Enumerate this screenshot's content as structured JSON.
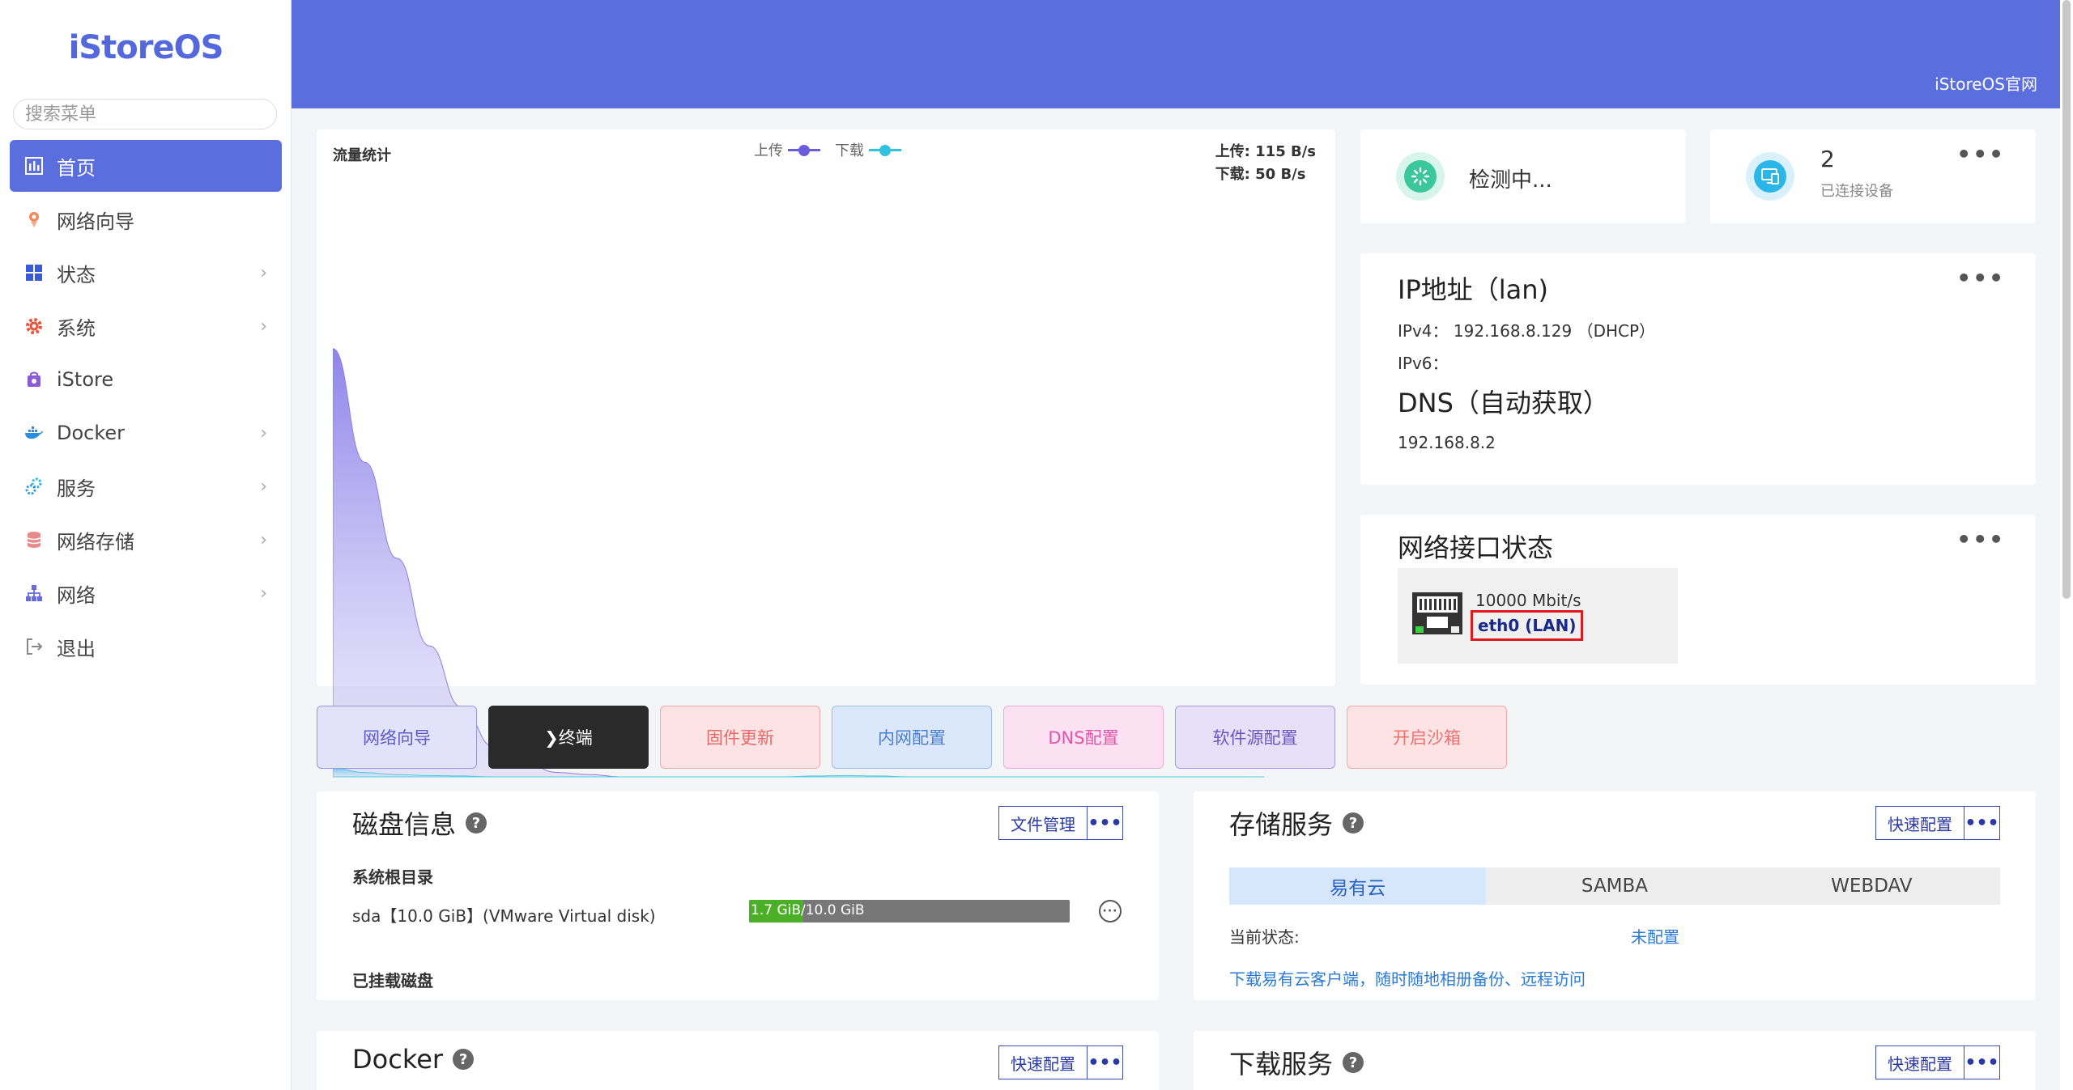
{
  "sidebar": {
    "logo": "iStoreOS",
    "search_placeholder": "搜索菜单",
    "items": [
      {
        "label": "首页",
        "active": true,
        "has_children": false,
        "icon": "dashboard-icon"
      },
      {
        "label": "网络向导",
        "active": false,
        "has_children": false,
        "icon": "location-icon"
      },
      {
        "label": "状态",
        "active": false,
        "has_children": true,
        "icon": "grid-icon"
      },
      {
        "label": "系统",
        "active": false,
        "has_children": true,
        "icon": "gear-icon"
      },
      {
        "label": "iStore",
        "active": false,
        "has_children": false,
        "icon": "store-icon"
      },
      {
        "label": "Docker",
        "active": false,
        "has_children": true,
        "icon": "docker-icon"
      },
      {
        "label": "服务",
        "active": false,
        "has_children": true,
        "icon": "services-icon"
      },
      {
        "label": "网络存储",
        "active": false,
        "has_children": true,
        "icon": "database-icon"
      },
      {
        "label": "网络",
        "active": false,
        "has_children": true,
        "icon": "network-icon"
      },
      {
        "label": "退出",
        "active": false,
        "has_children": false,
        "icon": "logout-icon"
      }
    ]
  },
  "header": {
    "official_link": "iStoreOS官网",
    "color": "#5a6fdd"
  },
  "traffic": {
    "title": "流量统计",
    "legend_upload": "上传",
    "legend_download": "下载",
    "upload_rate": "上传: 115 B/s",
    "download_rate": "下载: 50 B/s",
    "upload_color": "#6a5ce0",
    "download_color": "#2fc3e0"
  },
  "chart_data": {
    "type": "area",
    "series": [
      {
        "name": "上传",
        "values": [
          98,
          72,
          50,
          30,
          16,
          7,
          3,
          1,
          0.5,
          0,
          0,
          0,
          0,
          0,
          0,
          0,
          0,
          0,
          0,
          0,
          0,
          0,
          0,
          0,
          0,
          0,
          0,
          0,
          0,
          0
        ]
      },
      {
        "name": "下载",
        "values": [
          2,
          1,
          0.5,
          0.3,
          0.2,
          0,
          0,
          0,
          0,
          0,
          0,
          0,
          0,
          0,
          0,
          0.2,
          0.3,
          0.2,
          0,
          0,
          0,
          0,
          0,
          0,
          0,
          0,
          0,
          0,
          0,
          0
        ]
      }
    ],
    "title": "流量统计",
    "grid": false
  },
  "status": {
    "detect_text": "检测中...",
    "device_count": "2",
    "device_label": "已连接设备"
  },
  "ip": {
    "title": "IP地址（lan)",
    "ipv4_label": "IPv4：",
    "ipv4_value": "192.168.8.129 （DHCP）",
    "ipv6_label": "IPv6：",
    "dns_title": "DNS（自动获取）",
    "dns_value": "192.168.8.2"
  },
  "netif": {
    "title": "网络接口状态",
    "speed": "10000 Mbit/s",
    "name": "eth0 (LAN)"
  },
  "quick_buttons": [
    {
      "label": "网络向导",
      "bg": "#e3e2fb",
      "border": "#9b96e3",
      "color": "#5a5bc8"
    },
    {
      "label": "❯终端",
      "bg": "#2a2a2a",
      "border": "#2a2a2a",
      "color": "#ffffff"
    },
    {
      "label": "固件更新",
      "bg": "#fde3e3",
      "border": "#f0a8a8",
      "color": "#e56a6a"
    },
    {
      "label": "内网配置",
      "bg": "#dbe8fb",
      "border": "#9dbde8",
      "color": "#4a7ed0"
    },
    {
      "label": "DNS配置",
      "bg": "#fce1f2",
      "border": "#eeaad4",
      "color": "#e056a8"
    },
    {
      "label": "软件源配置",
      "bg": "#e6e1f9",
      "border": "#a799e0",
      "color": "#6a55c2"
    },
    {
      "label": "开启沙箱",
      "bg": "#fde3e3",
      "border": "#f0a8a8",
      "color": "#f07070"
    }
  ],
  "disk": {
    "title": "磁盘信息",
    "help": "?",
    "button": "文件管理",
    "more": "•••",
    "root_label": "系统根目录",
    "disk_line": "sda【10.0 GiB】(VMware Virtual disk)",
    "usage_text": "1.7 GiB/10.0 GiB",
    "usage_fraction": 0.17,
    "mounted_label": "已挂载磁盘"
  },
  "storage": {
    "title": "存储服务",
    "help": "?",
    "button": "快速配置",
    "more": "•••",
    "tabs": [
      "易有云",
      "SAMBA",
      "WEBDAV"
    ],
    "status_label": "当前状态:",
    "status_value": "未配置",
    "link": "下载易有云客户端，随时随地相册备份、远程访问"
  },
  "docker": {
    "title": "Docker",
    "help": "?",
    "button": "快速配置",
    "more": "•••"
  },
  "download": {
    "title": "下载服务",
    "help": "?",
    "button": "快速配置",
    "more": "•••"
  }
}
